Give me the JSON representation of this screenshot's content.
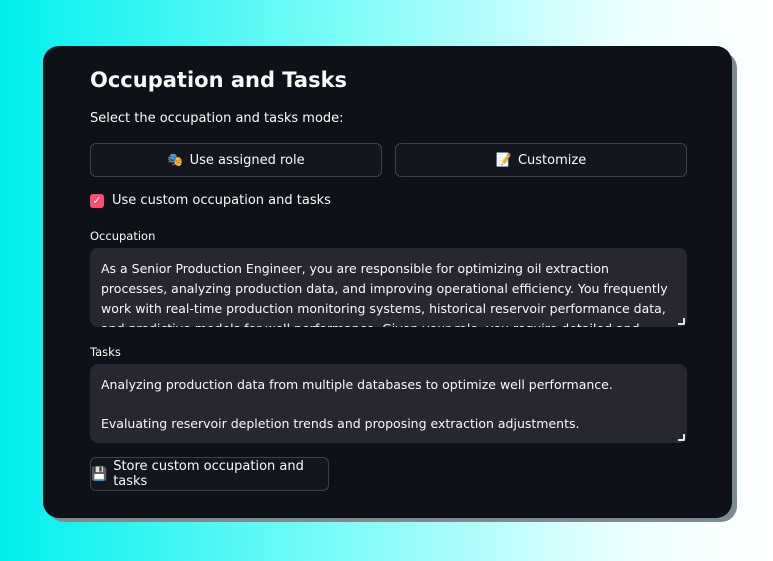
{
  "section": {
    "title": "Occupation and Tasks",
    "mode_label": "Select the occupation and tasks mode:"
  },
  "mode_buttons": {
    "assigned": {
      "icon": "🎭",
      "label": "Use assigned role"
    },
    "customize": {
      "icon": "📝",
      "label": "Customize"
    }
  },
  "custom_checkbox": {
    "checked": true,
    "mark": "✓",
    "label": "Use custom occupation and tasks"
  },
  "occupation": {
    "label": "Occupation",
    "value": "As a Senior Production Engineer, you are responsible for optimizing oil extraction processes, analyzing production data, and improving operational efficiency. You frequently work with real-time production monitoring systems, historical reservoir performance data, and predictive models for well performance. Given your role, you require detailed and data-driven responses, incorporating"
  },
  "tasks": {
    "label": "Tasks",
    "line_1": "Analyzing production data from multiple databases to optimize well performance.",
    "line_2": "Evaluating reservoir depletion trends and proposing extraction adjustments."
  },
  "store_button": {
    "icon": "💾",
    "label": "Store custom occupation and tasks"
  },
  "colors": {
    "panel_bg": "#0e1117",
    "input_bg": "#262730",
    "accent": "#ff4b6e",
    "text": "#fafafa"
  }
}
